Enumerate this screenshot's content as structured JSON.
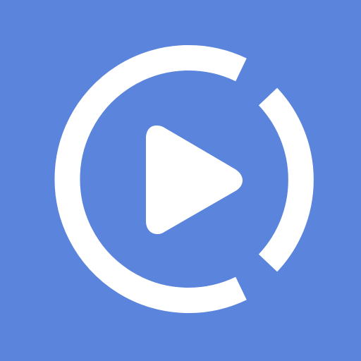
{
  "app_icon": {
    "icon_name": "play-ring-icon",
    "description_name": "app-logo",
    "colors": {
      "background": "#5b84dc",
      "foreground": "#ffffff"
    }
  }
}
